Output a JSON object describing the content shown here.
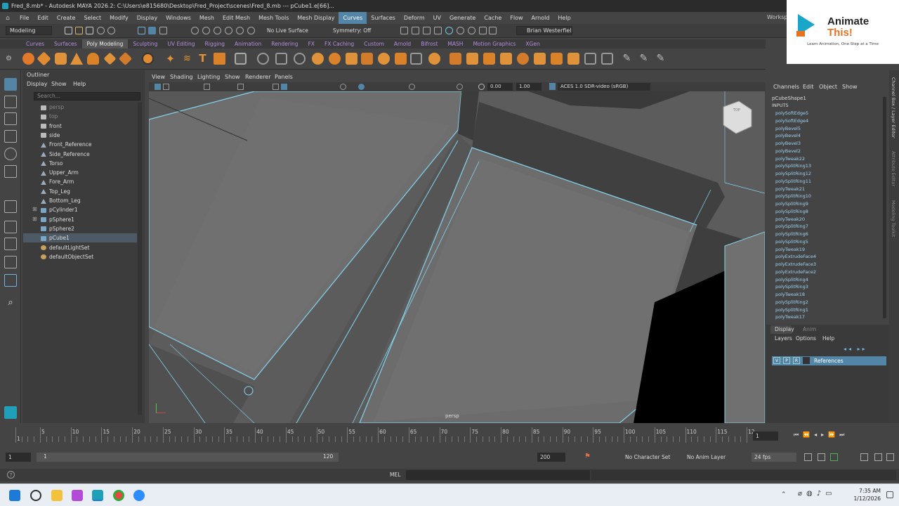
{
  "titlebar": {
    "text": "Fred_8.mb* - Autodesk MAYA 2026.2: C:\\Users\\e815680\\Desktop\\Fred_Project\\scenes\\Fred_8.mb   ---   pCube1.e[66]..."
  },
  "menubar": {
    "items": [
      "File",
      "Edit",
      "Create",
      "Select",
      "Modify",
      "Display",
      "Windows",
      "Mesh",
      "Edit Mesh",
      "Mesh Tools",
      "Mesh Display",
      "Curves",
      "Surfaces",
      "Deform",
      "UV",
      "Generate",
      "Cache",
      "Flow",
      "Arnold",
      "Help"
    ],
    "active": "Curves",
    "workspace_label": "Worksp"
  },
  "statusline": {
    "mode": "Modeling",
    "live_surface": "No Live Surface",
    "symmetry": "Symmetry: Off",
    "user": "Brian Westerfiel"
  },
  "shelf": {
    "tabs": [
      "Curves",
      "Surfaces",
      "Poly Modeling",
      "Sculpting",
      "UV Editing",
      "Rigging",
      "Animation",
      "Rendering",
      "FX",
      "FX Caching",
      "Custom",
      "Arnold",
      "Bifrost",
      "MASH",
      "Motion Graphics",
      "XGen"
    ],
    "active": "Poly Modeling"
  },
  "outliner": {
    "title": "Outliner",
    "menu": [
      "Display",
      "Show",
      "Help"
    ],
    "search_placeholder": "Search...",
    "items": [
      {
        "label": "persp",
        "kind": "camera",
        "dim": true
      },
      {
        "label": "top",
        "kind": "camera",
        "dim": true
      },
      {
        "label": "front",
        "kind": "camera",
        "dim": false
      },
      {
        "label": "side",
        "kind": "camera",
        "dim": false
      },
      {
        "label": "Front_Reference",
        "kind": "ref",
        "dim": false
      },
      {
        "label": "Side_Reference",
        "kind": "ref",
        "dim": false
      },
      {
        "label": "Torso",
        "kind": "ref",
        "dim": false
      },
      {
        "label": "Upper_Arm",
        "kind": "ref",
        "dim": false
      },
      {
        "label": "Fore_Arm",
        "kind": "ref",
        "dim": false
      },
      {
        "label": "Top_Leg",
        "kind": "ref",
        "dim": false
      },
      {
        "label": "Bottom_Leg",
        "kind": "ref",
        "dim": false
      },
      {
        "label": "pCylinder1",
        "kind": "poly",
        "dim": false,
        "expand": true
      },
      {
        "label": "pSphere1",
        "kind": "poly",
        "dim": false,
        "expand": true
      },
      {
        "label": "pSphere2",
        "kind": "poly",
        "dim": false
      },
      {
        "label": "pCube1",
        "kind": "poly",
        "dim": false,
        "selected": true
      },
      {
        "label": "defaultLightSet",
        "kind": "set",
        "dim": false
      },
      {
        "label": "defaultObjectSet",
        "kind": "set",
        "dim": false
      }
    ]
  },
  "viewport": {
    "menu": [
      "View",
      "Shading",
      "Lighting",
      "Show",
      "Renderer",
      "Panels"
    ],
    "exposure": "0.00",
    "gamma": "1.00",
    "colorspace": "ACES 1.0 SDR-video (sRGB)",
    "camera_label": "persp",
    "viewcube_label": "TOP"
  },
  "channelbox": {
    "menu": [
      "Channels",
      "Edit",
      "Object",
      "Show"
    ],
    "object": "pCubeShape1",
    "inputs_label": "INPUTS",
    "inputs": [
      "polySoftEdge5",
      "polySoftEdge4",
      "polyBevel5",
      "polyBevel4",
      "polyBevel3",
      "polyBevel2",
      "polyTweak22",
      "polySplitRing13",
      "polySplitRing12",
      "polySplitRing11",
      "polyTweak21",
      "polySplitRing10",
      "polySplitRing9",
      "polySplitRing8",
      "polyTweak20",
      "polySplitRing7",
      "polySplitRing6",
      "polySplitRing5",
      "polyTweak19",
      "polyExtrudeFace4",
      "polyExtrudeFace3",
      "polyExtrudeFace2",
      "polySplitRing4",
      "polySplitRing3",
      "polyTweak18",
      "polySplitRing2",
      "polySplitRing1",
      "polyTweak17"
    ]
  },
  "layers": {
    "tabs": [
      "Display",
      "Anim"
    ],
    "menu": [
      "Layers",
      "Options",
      "Help"
    ],
    "layer_flags": [
      "V",
      "P",
      "R"
    ],
    "layer_name": "References"
  },
  "right_strip": [
    "Channel Box / Layer Editor",
    "Attribute Editor",
    "Modeling Toolkit"
  ],
  "timeline": {
    "ticks": [
      "1",
      "5",
      "10",
      "15",
      "20",
      "25",
      "30",
      "35",
      "40",
      "45",
      "50",
      "55",
      "60",
      "65",
      "70",
      "75",
      "80",
      "85",
      "90",
      "95",
      "100",
      "105",
      "110",
      "115",
      "12"
    ],
    "current_frame": "1",
    "range_start": "1",
    "range_inner_start": "1",
    "range_inner_end": "120",
    "range_end": "200",
    "character_set": "No Character Set",
    "anim_layer": "No Anim Layer",
    "fps": "24 fps"
  },
  "cmdline": {
    "label": "MEL"
  },
  "taskbar": {
    "time": "7:35 AM",
    "date": "1/12/2026"
  },
  "brand": {
    "line1": "Animate",
    "line2": "This!",
    "tagline": "Learn Animation, One Step at a Time"
  }
}
